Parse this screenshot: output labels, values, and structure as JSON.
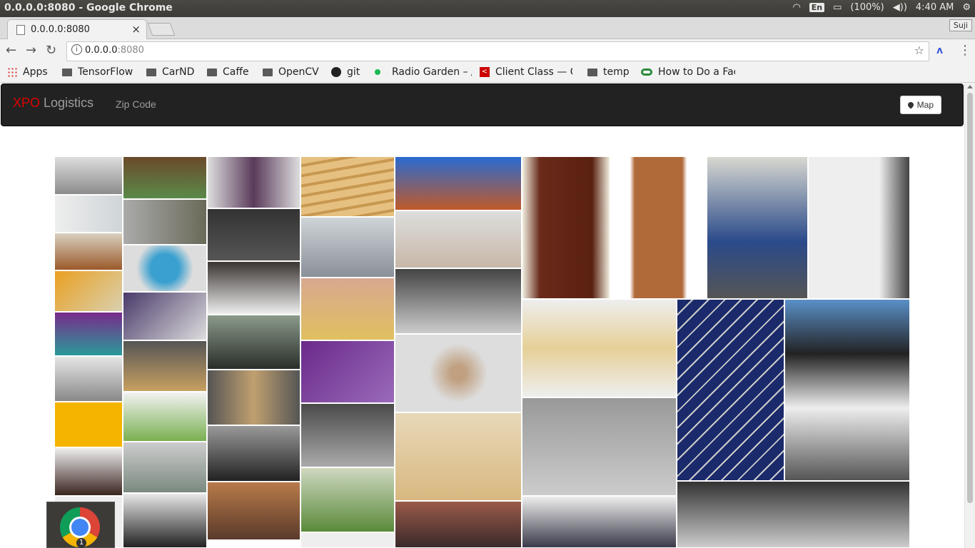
{
  "os_bar": {
    "window_title": "0.0.0.0:8080 - Google Chrome",
    "language": "En",
    "battery": "(100%)",
    "time": "4:40 AM"
  },
  "browser": {
    "tab_title": "0.0.0.0:8080",
    "tab_close": "×",
    "user_label": "Suji",
    "url_host": "0.0.0.0",
    "url_port": ":8080",
    "back": "←",
    "forward": "→",
    "reload": "↻",
    "star": "☆",
    "menu": "⋮"
  },
  "bookmarks": [
    {
      "label": "Apps",
      "icon": "apps-grid-icon"
    },
    {
      "label": "TensorFlow",
      "icon": "folder-icon"
    },
    {
      "label": "CarND",
      "icon": "folder-icon"
    },
    {
      "label": "Caffe",
      "icon": "folder-icon"
    },
    {
      "label": "OpenCV",
      "icon": "folder-icon"
    },
    {
      "label": "git",
      "icon": "github-icon"
    },
    {
      "label": "Radio Garden – /",
      "icon": "green-dot-icon"
    },
    {
      "label": "Client Class — C",
      "icon": "red-icon"
    },
    {
      "label": "temp",
      "icon": "folder-icon"
    },
    {
      "label": "How to Do a Fac",
      "icon": "green-circles-icon"
    }
  ],
  "navbar": {
    "brand_accent": "XPO",
    "brand_rest": " Logistics",
    "link_zip": "Zip Code",
    "map_button": "Map"
  },
  "gallery_colors": {
    "wood": "#d9b77a",
    "dark": "#3b3b3b",
    "steel": "#b9bcbf",
    "solar": "#2d3a7a",
    "green": "#6a8a4a",
    "white": "#eeeeee",
    "purple": "#5b2a7e"
  }
}
